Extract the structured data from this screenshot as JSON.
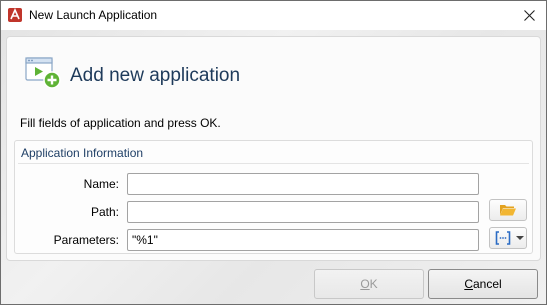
{
  "window": {
    "title": "New Launch Application",
    "close_symbol": "✕"
  },
  "header": {
    "title": "Add new application",
    "icon": "app-add-icon"
  },
  "instructions": "Fill fields of application and press OK.",
  "group": {
    "title": "Application Information",
    "fields": {
      "name": {
        "label": "Name:",
        "value": ""
      },
      "path": {
        "label": "Path:",
        "value": ""
      },
      "parameters": {
        "label": "Parameters:",
        "value": "\"%1\""
      }
    }
  },
  "buttons": {
    "ok": {
      "accel": "O",
      "rest": "K",
      "enabled": false
    },
    "cancel": {
      "accel": "C",
      "rest": "ancel",
      "enabled": true
    }
  },
  "colors": {
    "title_text": "#1e3a5a",
    "group_title": "#1f3f66",
    "app_icon_red": "#c0352b",
    "add_green": "#5fb336",
    "folder_yellow": "#f2b632",
    "params_blue": "#2b6cc4"
  }
}
